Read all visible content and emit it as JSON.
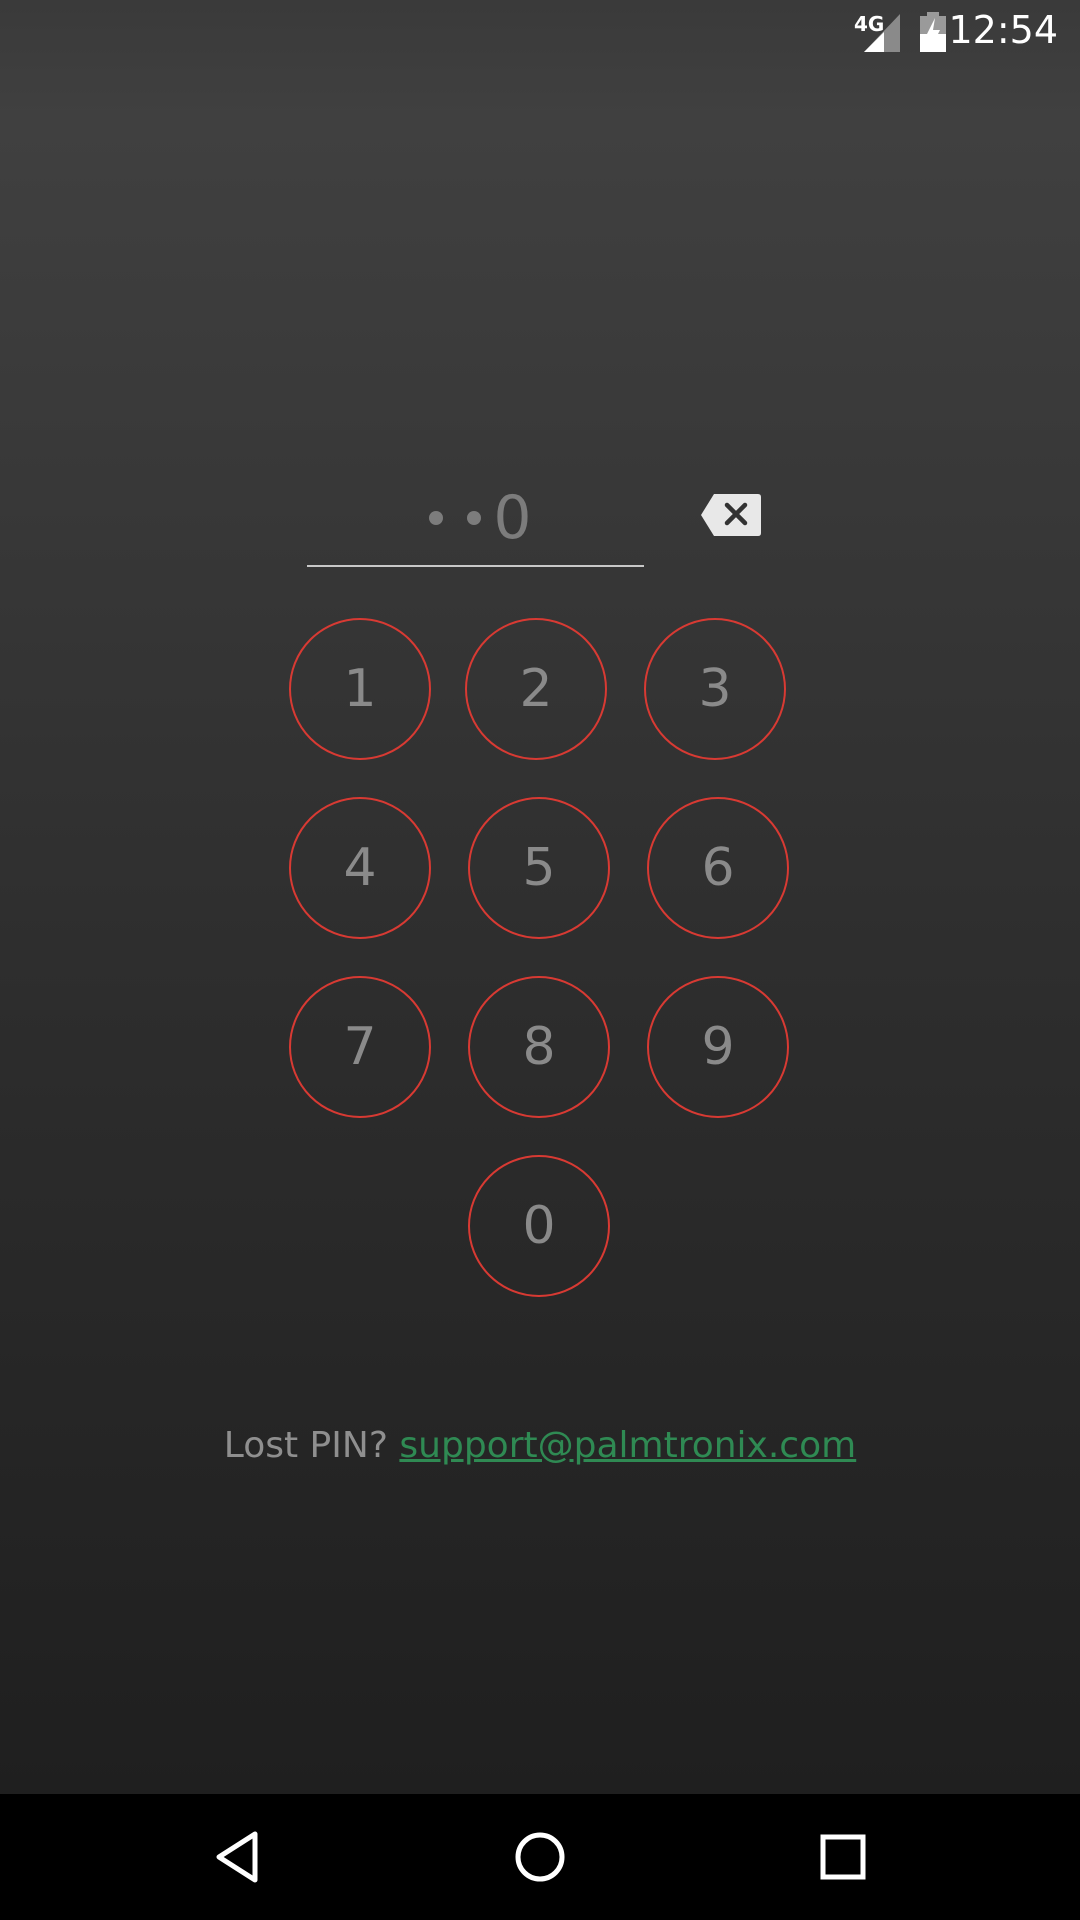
{
  "status_bar": {
    "network": "4G",
    "time": "12:54",
    "icons": [
      "signal-icon",
      "battery-charging-icon"
    ]
  },
  "pin": {
    "masked_count": 2,
    "last_digit": "0",
    "backspace_icon": "backspace-icon"
  },
  "keypad": {
    "keys": [
      "1",
      "2",
      "3",
      "4",
      "5",
      "6",
      "7",
      "8",
      "9",
      "0"
    ]
  },
  "footer": {
    "lost_pin_text": "Lost PIN?",
    "support_email": "support@palmtronix.com"
  },
  "navigation": {
    "back_icon": "back-triangle-icon",
    "home_icon": "home-circle-icon",
    "recents_icon": "recents-square-icon"
  },
  "colors": {
    "key_border": "#d83a33",
    "link": "#2f8a53",
    "key_text": "#8a8a8a"
  }
}
